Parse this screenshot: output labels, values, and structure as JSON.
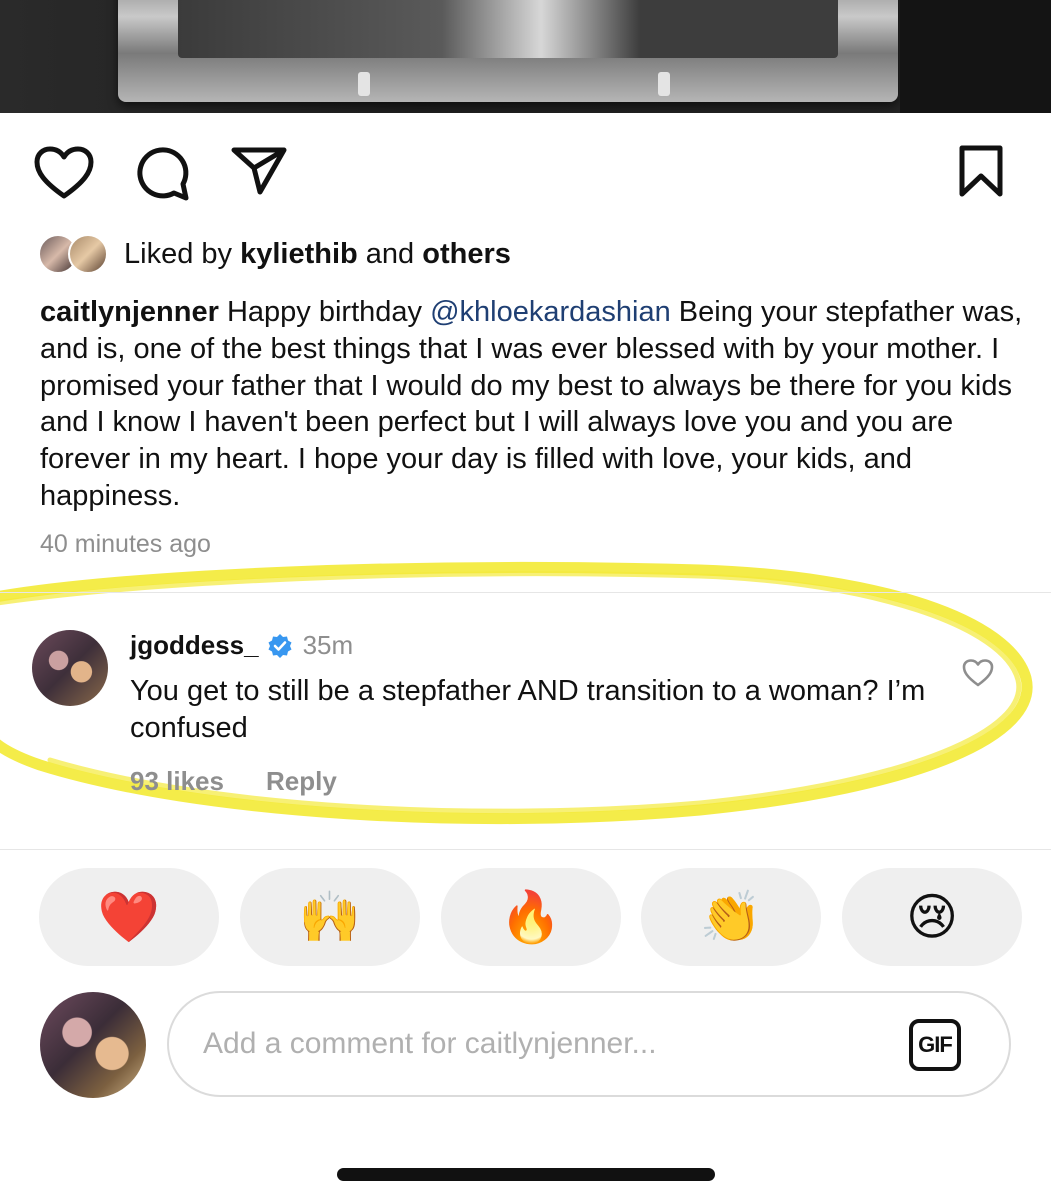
{
  "post": {
    "liked_by_prefix": "Liked by",
    "liked_by_user": "kyliethib",
    "liked_by_and": "and",
    "liked_by_others": "others",
    "caption_user": "caitlynjenner",
    "caption_part1": "Happy birthday",
    "caption_mention": "@khloekardashian",
    "caption_part2": "Being your stepfather was, and is, one of the best things that I was ever blessed with by your mother. I promised your father that I would do my best to always be there for you kids and I know I haven't been perfect but I will always love you and you are forever in my heart. I hope your day is filled with love, your kids, and happiness.",
    "timestamp": "40 minutes ago"
  },
  "comment": {
    "username": "jgoddess_",
    "time": "35m",
    "text": "You get to still be a stepfather AND transition to a woman? I’m confused",
    "likes": "93 likes",
    "reply_label": "Reply"
  },
  "reactions": [
    "❤️",
    "🙌",
    "🔥",
    "👏",
    "😢"
  ],
  "composer": {
    "placeholder": "Add a comment for caitlynjenner...",
    "gif_label": "GIF"
  },
  "icons": {
    "actions": [
      "heart-icon",
      "comment-icon",
      "share-icon",
      "bookmark-icon"
    ],
    "comment_like": "heart-icon",
    "verified": "verified-badge-icon"
  },
  "colors": {
    "mention": "#1f3f73",
    "muted": "#8e8e8e",
    "verified": "#3897f0",
    "highlight": "#f3ea3a",
    "pill_bg": "#efefef"
  }
}
